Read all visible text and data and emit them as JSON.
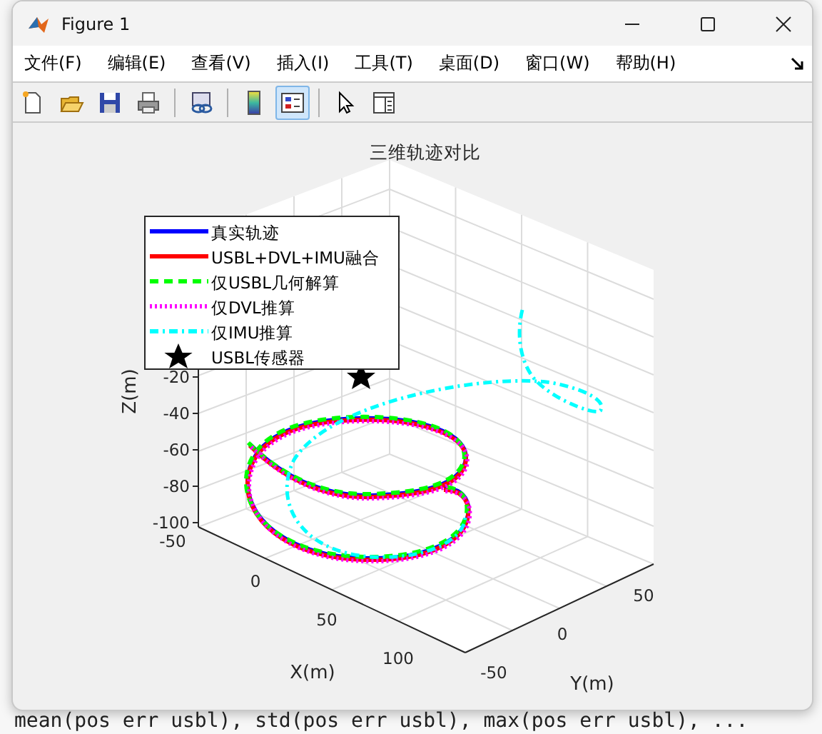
{
  "window": {
    "title": "Figure 1"
  },
  "menu": [
    "文件(F)",
    "编辑(E)",
    "查看(V)",
    "插入(I)",
    "工具(T)",
    "桌面(D)",
    "窗口(W)",
    "帮助(H)"
  ],
  "toolbar": [
    {
      "kind": "new",
      "selected": false
    },
    {
      "kind": "open",
      "selected": false
    },
    {
      "kind": "save",
      "selected": false
    },
    {
      "kind": "print",
      "selected": false
    },
    {
      "kind": "link",
      "selected": false
    },
    {
      "kind": "colorbar",
      "selected": false
    },
    {
      "kind": "legend",
      "selected": true
    },
    {
      "kind": "pointer",
      "selected": false
    },
    {
      "kind": "panel",
      "selected": false
    }
  ],
  "plot": {
    "title": "三维轨迹对比",
    "xlabel": "X(m)",
    "ylabel": "Y(m)",
    "zlabel": "Z(m)",
    "xticks": [
      "-50",
      "0",
      "50",
      "100"
    ],
    "yticks": [
      "-50",
      "0",
      "50"
    ],
    "zticks": [
      "-20",
      "-40",
      "-60",
      "-80",
      "-100"
    ],
    "legend": [
      {
        "label": "真实轨迹",
        "kind": "solid",
        "color": "#0000ff"
      },
      {
        "label": "USBL+DVL+IMU融合",
        "kind": "solid",
        "color": "#ff0000"
      },
      {
        "label": "仅USBL几何解算",
        "kind": "dashed",
        "color": "#00ff00"
      },
      {
        "label": "仅DVL推算",
        "kind": "dotted",
        "color": "#ff00ff"
      },
      {
        "label": "仅IMU推算",
        "kind": "dashdot",
        "color": "#00ffff"
      },
      {
        "label": "USBL传感器",
        "kind": "star",
        "color": "#000000"
      }
    ]
  },
  "background_code": "mean(pos err usbl), std(pos err usbl), max(pos err usbl), ..."
}
